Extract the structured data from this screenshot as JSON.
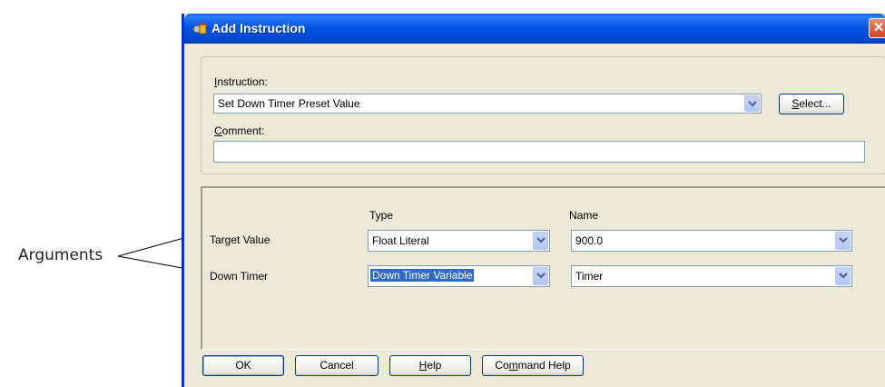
{
  "callout": {
    "label": "Arguments"
  },
  "dialog": {
    "title": "Add Instruction",
    "close_glyph": "✕",
    "icon": "add-instruction-icon"
  },
  "instruction": {
    "label_accel": "I",
    "label_rest": "nstruction:",
    "value": "Set Down Timer Preset Value",
    "select_accel": "S",
    "select_rest": "elect..."
  },
  "comment": {
    "label_accel": "C",
    "label_rest": "omment:",
    "value": ""
  },
  "arguments": {
    "type_header": "Type",
    "name_header": "Name",
    "rows": [
      {
        "label": "Target Value",
        "type": "Float Literal",
        "name": "900.0"
      },
      {
        "label": "Down Timer",
        "type": "Down Timer Variable",
        "name": "Timer"
      }
    ]
  },
  "buttons": {
    "ok": "OK",
    "cancel": "Cancel",
    "help_accel": "H",
    "help_rest": "elp",
    "cmd_help_pre": "Co",
    "cmd_help_accel": "m",
    "cmd_help_rest": "mand Help"
  },
  "colors": {
    "titlebar": "#0054e3",
    "dialog_face": "#ece9d8",
    "selection": "#316ac5",
    "close": "#c9432a"
  }
}
